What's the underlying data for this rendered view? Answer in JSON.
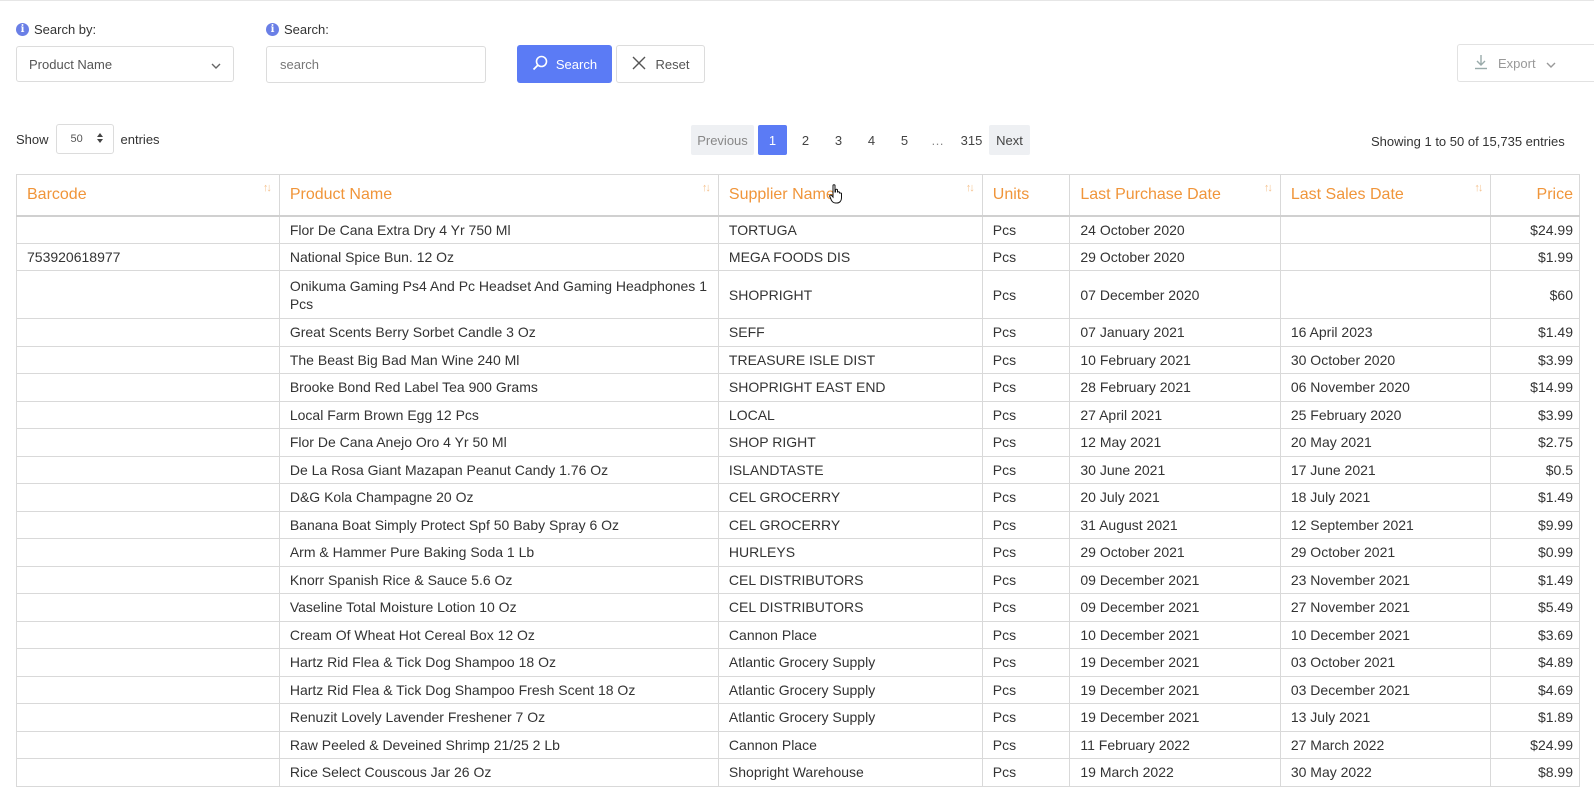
{
  "filters": {
    "search_by_label": "Search by:",
    "search_by_value": "Product Name",
    "search_label": "Search:",
    "search_placeholder": "search",
    "search_button": "Search",
    "reset_button": "Reset",
    "export_button": "Export"
  },
  "length": {
    "show_label": "Show",
    "value": "50",
    "entries_label": "entries"
  },
  "pagination": {
    "previous": "Previous",
    "pages": [
      "1",
      "2",
      "3",
      "4",
      "5"
    ],
    "ellipsis": "…",
    "last": "315",
    "next": "Next"
  },
  "info": "Showing 1 to 50 of 15,735 entries",
  "table": {
    "headers": [
      "Barcode",
      "Product Name",
      "Supplier Name",
      "Units",
      "Last Purchase Date",
      "Last Sales Date",
      "Price"
    ],
    "rows": [
      [
        "",
        "Flor De Cana Extra Dry 4 Yr 750 Ml",
        "TORTUGA",
        "Pcs",
        "24 October 2020",
        "",
        "$24.99"
      ],
      [
        "753920618977",
        "National Spice Bun. 12 Oz",
        "MEGA FOODS DIS",
        "Pcs",
        "29 October 2020",
        "",
        "$1.99"
      ],
      [
        "",
        "Onikuma Gaming Ps4 And Pc Headset And Gaming Headphones 1 Pcs",
        "SHOPRIGHT",
        "Pcs",
        "07 December 2020",
        "",
        "$60"
      ],
      [
        "",
        "Great Scents Berry Sorbet Candle 3 Oz",
        "SEFF",
        "Pcs",
        "07 January 2021",
        "16 April 2023",
        "$1.49"
      ],
      [
        "",
        "The Beast Big Bad Man Wine 240 Ml",
        "TREASURE ISLE DIST",
        "Pcs",
        "10 February 2021",
        "30 October 2020",
        "$3.99"
      ],
      [
        "",
        "Brooke Bond Red Label Tea 900 Grams",
        "SHOPRIGHT EAST END",
        "Pcs",
        "28 February 2021",
        "06 November 2020",
        "$14.99"
      ],
      [
        "",
        "Local Farm Brown Egg 12 Pcs",
        "LOCAL",
        "Pcs",
        "27 April 2021",
        "25 February 2020",
        "$3.99"
      ],
      [
        "",
        "Flor De Cana Anejo Oro 4 Yr 50 Ml",
        "SHOP RIGHT",
        "Pcs",
        "12 May 2021",
        "20 May 2021",
        "$2.75"
      ],
      [
        "",
        "De La Rosa Giant Mazapan Peanut Candy 1.76 Oz",
        "ISLANDTASTE",
        "Pcs",
        "30 June 2021",
        "17 June 2021",
        "$0.5"
      ],
      [
        "",
        "D&G Kola Champagne 20 Oz",
        "CEL GROCERRY",
        "Pcs",
        "20 July 2021",
        "18 July 2021",
        "$1.49"
      ],
      [
        "",
        "Banana Boat Simply Protect Spf 50 Baby Spray 6 Oz",
        "CEL GROCERRY",
        "Pcs",
        "31 August 2021",
        "12 September 2021",
        "$9.99"
      ],
      [
        "",
        "Arm & Hammer Pure Baking Soda 1 Lb",
        "HURLEYS",
        "Pcs",
        "29 October 2021",
        "29 October 2021",
        "$0.99"
      ],
      [
        "",
        "Knorr Spanish Rice & Sauce 5.6 Oz",
        "CEL DISTRIBUTORS",
        "Pcs",
        "09 December 2021",
        "23 November 2021",
        "$1.49"
      ],
      [
        "",
        "Vaseline Total Moisture Lotion 10 Oz",
        "CEL DISTRIBUTORS",
        "Pcs",
        "09 December 2021",
        "27 November 2021",
        "$5.49"
      ],
      [
        "",
        "Cream Of Wheat Hot Cereal Box 12 Oz",
        "Cannon Place",
        "Pcs",
        "10 December 2021",
        "10 December 2021",
        "$3.69"
      ],
      [
        "",
        "Hartz Rid Flea & Tick Dog Shampoo 18 Oz",
        "Atlantic Grocery Supply",
        "Pcs",
        "19 December 2021",
        "03 October 2021",
        "$4.89"
      ],
      [
        "",
        "Hartz Rid Flea & Tick Dog Shampoo Fresh Scent 18 Oz",
        "Atlantic Grocery Supply",
        "Pcs",
        "19 December 2021",
        "03 December 2021",
        "$4.69"
      ],
      [
        "",
        "Renuzit Lovely Lavender Freshener 7 Oz",
        "Atlantic Grocery Supply",
        "Pcs",
        "19 December 2021",
        "13 July 2021",
        "$1.89"
      ],
      [
        "",
        "Raw Peeled & Deveined Shrimp 21/25 2 Lb",
        "Cannon Place",
        "Pcs",
        "11 February 2022",
        "27 March 2022",
        "$24.99"
      ],
      [
        "",
        "Rice Select Couscous Jar 26 Oz",
        "Shopright Warehouse",
        "Pcs",
        "19 March 2022",
        "30 May 2022",
        "$8.99"
      ]
    ]
  },
  "colors": {
    "accent": "#5b7bf5",
    "header_text": "#f0953a"
  }
}
